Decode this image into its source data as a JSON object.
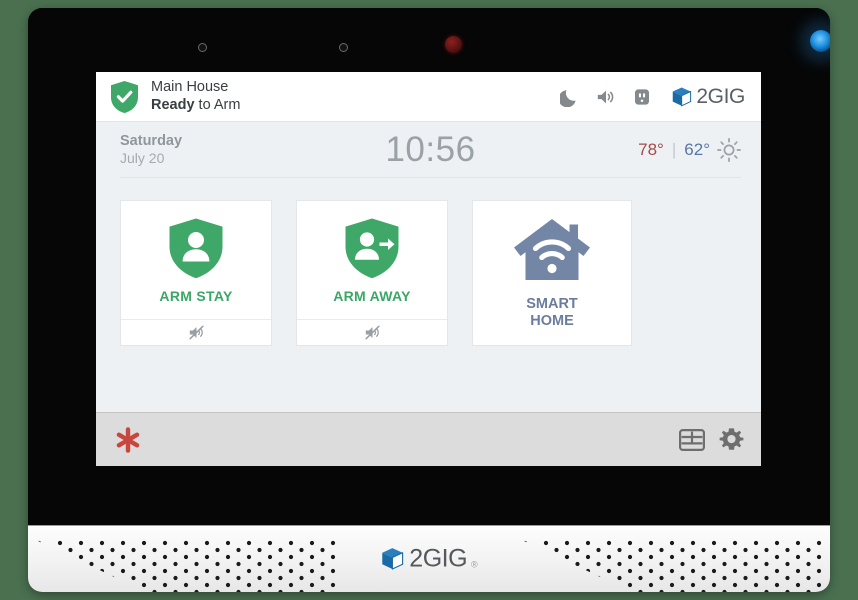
{
  "theme": {
    "background": "#4a7050",
    "bezel": "#060606",
    "screen_bg": "#eef1f4",
    "header_bg": "#ffffff",
    "accent_green": "#3aa765",
    "smart_home_blue": "#6b7d9c",
    "emergency_red": "#c9463f",
    "toolbar_bg": "#dcdcdc",
    "temp_high_color": "#a24b4b",
    "temp_low_color": "#5877a8"
  },
  "device": {
    "sensor_left": "proximity-sensor",
    "sensor_mid": "ambient-light-sensor",
    "camera": "camera-lens",
    "power_led": "power-led"
  },
  "header": {
    "status_icon": "shield-check-icon",
    "panel_name": "Main House",
    "state_bold": "Ready",
    "state_rest": " to Arm",
    "icons": [
      {
        "name": "moon-icon",
        "label": "Night Mode"
      },
      {
        "name": "volume-icon",
        "label": "Volume"
      },
      {
        "name": "outlet-icon",
        "label": "Power Outlet"
      }
    ],
    "brand": {
      "mark": "2gig-cube-logo",
      "text": "2GIG"
    }
  },
  "status_row": {
    "weekday": "Saturday",
    "monthday": "July 20",
    "clock": "10:56",
    "weather": {
      "high": "78°",
      "separator": "|",
      "low": "62°",
      "condition_icon": "sun-icon"
    }
  },
  "cards": [
    {
      "name": "arm-stay",
      "label": "ARM STAY",
      "icon": "shield-person-icon",
      "footer_icon": "mute-icon",
      "has_footer": true
    },
    {
      "name": "arm-away",
      "label": "ARM AWAY",
      "icon": "shield-person-arrow-icon",
      "footer_icon": "mute-icon",
      "has_footer": true
    },
    {
      "name": "smart-home",
      "label_line1": "SMART",
      "label_line2": "HOME",
      "icon": "house-wifi-icon",
      "has_footer": false
    }
  ],
  "toolbar": {
    "emergency_icon": "emergency-asterisk-icon",
    "keypad_icon": "keypad-icon",
    "settings_icon": "gear-icon"
  },
  "speaker_panel": {
    "brand": {
      "mark": "2gig-cube-logo",
      "text": "2GIG",
      "tm": "®"
    }
  }
}
